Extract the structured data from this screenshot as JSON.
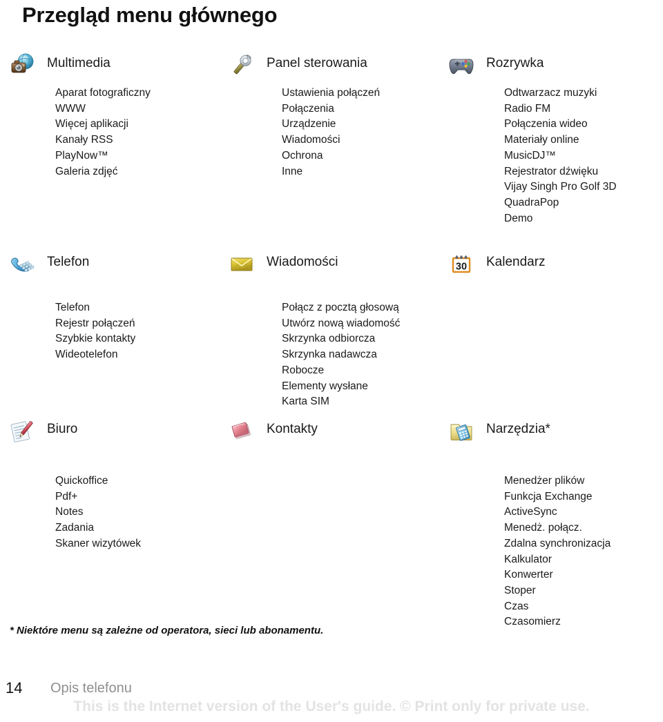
{
  "page": {
    "title": "Przegląd menu głównego",
    "footnote": "* Niektóre menu są zależne od operatora, sieci lub abonamentu.",
    "page_number": "14",
    "footer_label": "Opis telefonu",
    "watermark": "This is the Internet version of the User's guide. © Print only for private use.",
    "text_color": "#1a1a1a",
    "footer_color": "#8f8f8f",
    "watermark_color": "#e3e3e3",
    "background": "#ffffff"
  },
  "sections": [
    {
      "id": "multimedia",
      "title": "Multimedia",
      "icon": "camera-globe-icon",
      "items": [
        "Aparat fotograficzny",
        "WWW",
        "Więcej aplikacji",
        "Kanały RSS",
        "PlayNow™",
        "Galeria zdjęć"
      ]
    },
    {
      "id": "panel-sterowania",
      "title": "Panel sterowania",
      "icon": "wrench-icon",
      "items": [
        "Ustawienia połączeń",
        "Połączenia",
        "Urządzenie",
        "Wiadomości",
        "Ochrona",
        "Inne"
      ]
    },
    {
      "id": "rozrywka",
      "title": "Rozrywka",
      "icon": "gamepad-icon",
      "items": [
        "Odtwarzacz muzyki",
        "Radio FM",
        "Połączenia wideo",
        "Materiały online",
        "MusicDJ™",
        "Rejestrator dźwięku",
        "Vijay Singh Pro Golf 3D",
        "QuadraPop",
        "Demo"
      ]
    },
    {
      "id": "telefon",
      "title": "Telefon",
      "icon": "telephone-icon",
      "items": [
        "Telefon",
        "Rejestr połączeń",
        "Szybkie kontakty",
        "Wideotelefon"
      ]
    },
    {
      "id": "wiadomosci",
      "title": "Wiadomości",
      "icon": "envelope-icon",
      "items": [
        "Połącz z pocztą głosową",
        "Utwórz nową wiadomość",
        "Skrzynka odbiorcza",
        "Skrzynka nadawcza",
        "Robocze",
        "Elementy wysłane",
        "Karta SIM"
      ]
    },
    {
      "id": "kalendarz",
      "title": "Kalendarz",
      "icon": "calendar-icon",
      "icon_text": "30",
      "items": []
    },
    {
      "id": "biuro",
      "title": "Biuro",
      "icon": "notepad-pencil-icon",
      "items": [
        "Quickoffice",
        "Pdf+",
        "Notes",
        "Zadania",
        "Skaner wizytówek"
      ]
    },
    {
      "id": "kontakty",
      "title": "Kontakty",
      "icon": "pink-book-icon",
      "items": []
    },
    {
      "id": "narzedzia",
      "title": "Narzędzia*",
      "icon": "folder-calculator-icon",
      "items": [
        "Menedżer plików",
        "Funkcja Exchange",
        " ActiveSync",
        "Menedż. połącz.",
        "Zdalna synchronizacja",
        "Kalkulator",
        "Konwerter",
        "Stoper",
        "Czas",
        "Czasomierz"
      ]
    }
  ]
}
